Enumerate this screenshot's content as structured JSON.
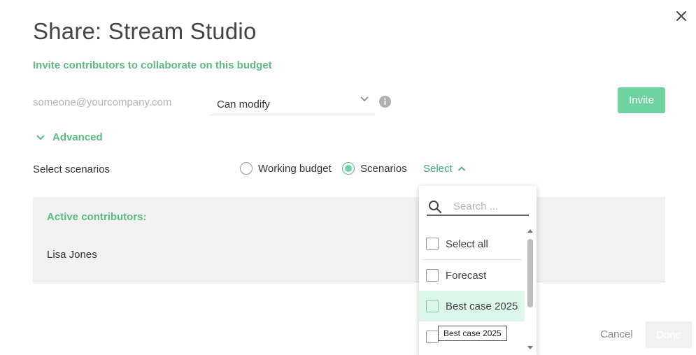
{
  "dialog": {
    "title": "Share: Stream Studio",
    "subtitle": "Invite contributors to collaborate on this budget"
  },
  "invite": {
    "email_placeholder": "someone@yourcompany.com",
    "email_value": "",
    "permission_value": "Can modify",
    "button_label": "Invite"
  },
  "advanced": {
    "label": "Advanced",
    "scenarios_label": "Select scenarios",
    "options": [
      {
        "label": "Working budget",
        "selected": false
      },
      {
        "label": "Scenarios",
        "selected": true
      }
    ],
    "select_label": "Select"
  },
  "contributors": {
    "title": "Active contributors:",
    "items": [
      {
        "name": "Lisa Jones"
      }
    ]
  },
  "dropdown": {
    "search_placeholder": "Search ...",
    "items": [
      {
        "label": "Select all",
        "checked": false
      },
      {
        "label": "Forecast",
        "checked": false
      },
      {
        "label": "Best case 2025",
        "checked": false,
        "hovered": true
      },
      {
        "label": "",
        "checked": false
      }
    ],
    "tooltip": "Best case 2025"
  },
  "footer": {
    "cancel_label": "Cancel",
    "done_label": "Done"
  },
  "colors": {
    "accent": "#5cbb82",
    "button": "#6fd3a0",
    "hover_row": "#dcf6e9",
    "panel_bg": "#f1f1f1"
  },
  "icons": {
    "close": "close-icon",
    "info": "info-icon",
    "chevron": "chevron-down-icon",
    "search": "search-icon"
  }
}
